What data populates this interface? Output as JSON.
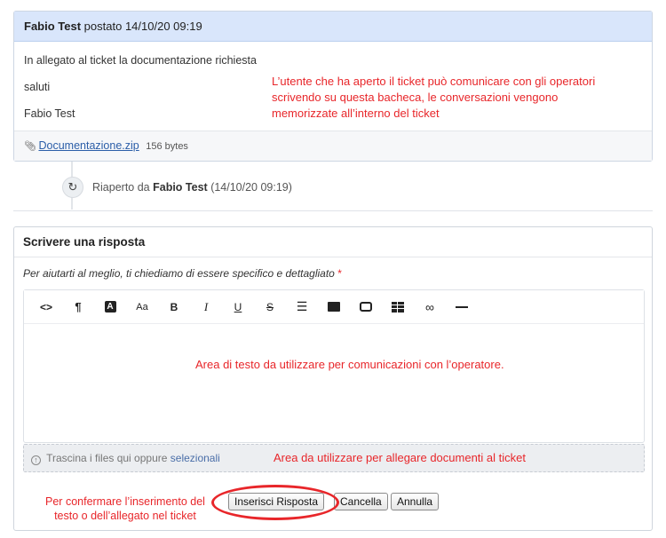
{
  "message": {
    "author": "Fabio Test",
    "posted_label": "postato",
    "timestamp": "14/10/20 09:19",
    "lines": [
      "In allegato al ticket la documentazione richiesta",
      "saluti",
      "Fabio Test"
    ],
    "attachment": {
      "name": "Documentazione.zip",
      "size": "156 bytes"
    }
  },
  "annotations": {
    "board": "L’utente che ha aperto il ticket può comunicare  con  gli operatori scrivendo su questa bacheca, le conversazioni vengono memorizzate all’interno del ticket",
    "text_area": "Area di testo da utilizzare  per comunicazioni con l’operatore.",
    "attach_area": "Area da  utilizzare per allegare documenti al  ticket",
    "confirm": "Per confermare l’inserimento del testo o dell’allegato nel ticket"
  },
  "event": {
    "prefix": "Riaperto da",
    "author": "Fabio Test",
    "time": "(14/10/20 09:19)"
  },
  "reply": {
    "title": "Scrivere una risposta",
    "hint": "Per aiutarti al meglio, ti chiediamo di essere specifico e dettagliato",
    "required_mark": "*",
    "toolbar": [
      "<>",
      "¶",
      "A",
      "Aa",
      "B",
      "I",
      "U",
      "S",
      "list",
      "image",
      "video",
      "table",
      "link",
      "rule"
    ],
    "dropzone": {
      "text": "Trascina i files qui oppure",
      "link": "selezionali"
    },
    "buttons": {
      "insert": "Inserisci Risposta",
      "cancel": "Cancella",
      "back": "Annulla"
    }
  },
  "colors": {
    "annotation": "#e8262a",
    "header_bg": "#d9e6fb",
    "link": "#2b5ea8"
  }
}
